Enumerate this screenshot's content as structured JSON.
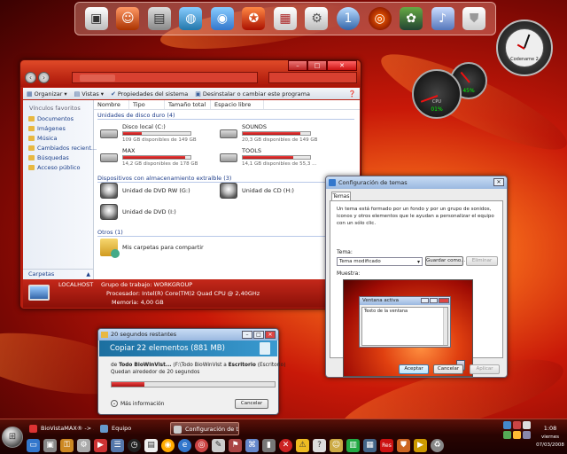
{
  "explorer": {
    "toolbar": {
      "organize": "Organizar",
      "views": "Vistas",
      "system_properties": "Propiedades del sistema",
      "uninstall": "Desinstalar o cambiar este programa"
    },
    "nav": {
      "title": "Vínculos favoritos",
      "items": [
        "Documentos",
        "Imágenes",
        "Música",
        "Cambiados recient...",
        "Búsquedas",
        "Acceso público"
      ],
      "footer": "Carpetas"
    },
    "columns": [
      "Nombre",
      "Tipo",
      "Tamaño total",
      "Espacio libre"
    ],
    "groups": {
      "hdd": "Unidades de disco duro (4)",
      "removable": "Dispositivos con almacenamiento extraíble (3)",
      "other": "Otros (1)"
    },
    "drives": [
      {
        "name": "Disco local (C:)",
        "free": "109 GB disponibles de 149 GB",
        "used_pct": 27
      },
      {
        "name": "SOUNDS",
        "free": "20,3 GB disponibles de 149 GB",
        "used_pct": 86
      },
      {
        "name": "MAX",
        "free": "14,2 GB disponibles de 178 GB",
        "used_pct": 92
      },
      {
        "name": "TOOLS",
        "free": "14,1 GB disponibles de 55,3 ...",
        "used_pct": 75
      }
    ],
    "dvds": [
      "Unidad de DVD RW (G:)",
      "Unidad de CD (H:)",
      "Unidad de DVD (I:)"
    ],
    "share": "Mis carpetas para compartir",
    "status": {
      "host": "LOCALHOST",
      "workgroup": "Grupo de trabajo: WORKGROUP",
      "processor": "Procesador: Intel(R) Core(TM)2 Quad CPU      @ 2,40GHz",
      "memory": "Memoria: 4,00 GB"
    }
  },
  "themes": {
    "title": "Configuración de temas",
    "tab": "Temas",
    "description": "Un tema está formado por un fondo y por un grupo de sonidos, iconos y otros elementos que le ayudan a personalizar el equipo con un sólo clic.",
    "theme_label": "Tema:",
    "selected_theme": "Tema modificado",
    "save_as": "Guardar como...",
    "delete": "Eliminar",
    "sample_label": "Muestra:",
    "preview_window_title": "Ventana activa",
    "preview_window_text": "Texto de la ventana",
    "accept": "Aceptar",
    "cancel": "Cancelar",
    "apply": "Aplicar"
  },
  "copy": {
    "title": "20 segundos restantes",
    "banner": "Copiar 22 elementos (881 MB)",
    "from_prefix": "de ",
    "from_bold": "Todo BioWinVist...",
    "path": " (F:\\Todo BioWinVist a ",
    "dest_bold": "Escritorio",
    "dest_tail": " (Escritorio)",
    "remaining": "Quedan alrededor de 20 segundos",
    "progress": 0.2,
    "more": "Más información",
    "cancel": "Cancelar"
  },
  "gadgets": {
    "clock_label": "Codename 2",
    "cpu_label": "CPU",
    "cpu_value": "01%",
    "ram_value": "45%"
  },
  "taskbar": {
    "buttons": [
      "BioVistaMAX® -> ...",
      "Equipo",
      "Configuración de te..."
    ],
    "time": "1:08",
    "day": "viernes",
    "date": "07/03/2008"
  },
  "colors": {
    "accent": "#c81808",
    "progress": "#d02020",
    "banner": "#1c6fa0"
  }
}
